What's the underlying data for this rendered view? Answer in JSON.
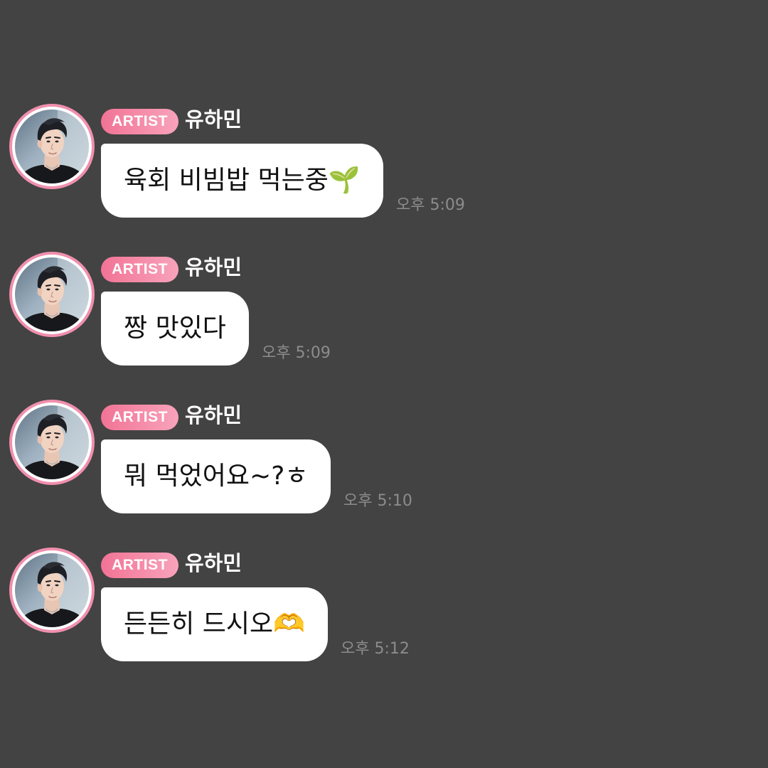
{
  "theme": {
    "background": "#434343",
    "badge_gradient": [
      "#f27395",
      "#f8a3bb"
    ],
    "avatar_ring": "#f08fae",
    "bubble": "#ffffff",
    "timestamp": "#8c8c8c"
  },
  "messages": [
    {
      "badge": "ARTIST",
      "sender": "유하민",
      "text": "육회 비빔밥 먹는중🌱",
      "time": "오후 5:09",
      "avatar_icon": "profile-avatar"
    },
    {
      "badge": "ARTIST",
      "sender": "유하민",
      "text": "짱 맛있다",
      "time": "오후 5:09",
      "avatar_icon": "profile-avatar"
    },
    {
      "badge": "ARTIST",
      "sender": "유하민",
      "text": "뭐 먹었어요~?ㅎ",
      "time": "오후 5:10",
      "avatar_icon": "profile-avatar"
    },
    {
      "badge": "ARTIST",
      "sender": "유하민",
      "text": "든든히 드시오🫶",
      "time": "오후 5:12",
      "avatar_icon": "profile-avatar"
    }
  ]
}
